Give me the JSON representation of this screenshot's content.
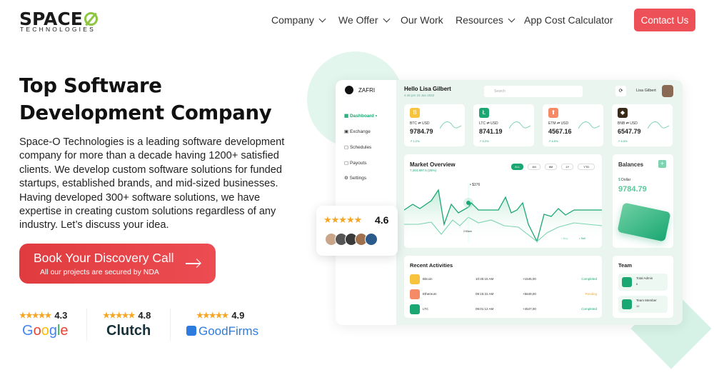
{
  "header": {
    "logo_main": "SPACE",
    "logo_sub": "TECHNOLOGIES",
    "nav": [
      {
        "label": "Company",
        "dropdown": true
      },
      {
        "label": "We Offer",
        "dropdown": true
      },
      {
        "label": "Our Work",
        "dropdown": false
      },
      {
        "label": "Resources",
        "dropdown": true
      },
      {
        "label": "App Cost Calculator",
        "dropdown": false
      }
    ],
    "contact": "Contact Us"
  },
  "hero": {
    "title_line1": "Top Software",
    "title_line2": "Development Company",
    "paragraph": "Space-O Technologies is a leading software development company for more than a decade having 1200+ satisfied clients. We develop custom software solutions for funded startups, established brands, and mid-sized businesses. Having developed 300+ software solutions, we have expertise in creating custom solutions regardless of any industry. Let’s discuss your idea.",
    "cta_title": "Book Your Discovery Call",
    "cta_sub": "All our projects are secured by NDA"
  },
  "ratings": [
    {
      "source": "Google",
      "score": "4.3",
      "stars": "★★★★★"
    },
    {
      "source": "Clutch",
      "score": "4.8",
      "stars": "★★★★★"
    },
    {
      "source": "GoodFirms",
      "score": "4.9",
      "stars": "★★★★★"
    }
  ],
  "popup": {
    "stars": "★★★★★",
    "score": "4.6"
  },
  "colors": {
    "accent": "#ee5058",
    "green": "#1aa772",
    "logo_green": "#8dc63f"
  },
  "dashboard": {
    "brand": "ZAFRI",
    "greeting": "Hello Lisa Gilbert",
    "datetime": "4:45 pm 15 Jan 2022",
    "search": "Search",
    "user": "Lisa Gilbert",
    "menu": [
      "Dashboard",
      "Exchange",
      "Schedules",
      "Payouts",
      "Settings"
    ],
    "coins": [
      {
        "pair": "BTC ⇄ USD",
        "value": "9784.79",
        "change": "1.2%",
        "color": "#f7c23c",
        "glyph": "B"
      },
      {
        "pair": "LTC ⇄ USD",
        "value": "8741.19",
        "change": "5.2%",
        "color": "#1aa772",
        "glyph": "Ł"
      },
      {
        "pair": "ETM ⇄ USD",
        "value": "4567.16",
        "change": "6.5%",
        "color": "#f58a66",
        "glyph": "⬆"
      },
      {
        "pair": "BNB ⇄ USD",
        "value": "6547.79",
        "change": "6.5%",
        "color": "#3a2a1a",
        "glyph": "◆"
      }
    ],
    "market": {
      "title": "Market Overview",
      "sub": "7,264,897.5 (25%)",
      "tabs": [
        "ALL",
        "1M",
        "6M",
        "1Y",
        "YTD"
      ],
      "point": "$376",
      "time": "2:50am",
      "legend": [
        "Buy",
        "Sell"
      ]
    },
    "balances": {
      "title": "Balances",
      "label": "Dollar",
      "value": "9784.79"
    },
    "activities": {
      "title": "Recent Activities",
      "rows": [
        {
          "name": "Bitcoin",
          "time": "10:45:15 AM",
          "amount": "+1545,00",
          "status": "Completed",
          "color": "#f7c23c"
        },
        {
          "name": "Ethereum",
          "time": "09:15:31 AM",
          "amount": "+5649,00",
          "status": "Pending",
          "color": "#f58a66"
        },
        {
          "name": "LTC",
          "time": "09:01:12 AM",
          "amount": "+4547,00",
          "status": "Completed",
          "color": "#1aa772"
        }
      ]
    },
    "team": {
      "title": "Team",
      "items": [
        {
          "label": "Total Admin",
          "count": "6"
        },
        {
          "label": "Team Member",
          "count": "12"
        }
      ]
    }
  }
}
